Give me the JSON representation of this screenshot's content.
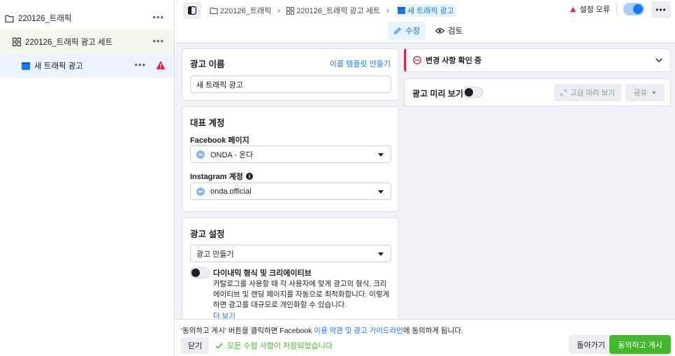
{
  "sidebar": {
    "campaign": "220126_트래픽",
    "adset": "220126_트래픽 광고 세트",
    "ad": "새 트래픽 광고",
    "more": "•••"
  },
  "topbar": {
    "breadcrumbs": [
      "220126_트래픽",
      "220126_트래픽 광고 세트",
      "새 트래픽 광고"
    ],
    "status": "설정 오류",
    "more": "•••",
    "tabs": {
      "edit": "수정",
      "review": "검토"
    }
  },
  "ad_name": {
    "title": "광고 이름",
    "template_link": "이름 템플릿 만들기",
    "value": "새 트래픽 광고"
  },
  "identity": {
    "title": "대표 계정",
    "facebook_label": "Facebook 페이지",
    "facebook_value": "ONDA - 온다",
    "instagram_label": "Instagram 계정",
    "instagram_value": "onda.official"
  },
  "ad_setup": {
    "title": "광고 설정",
    "select_value": "광고 만들기",
    "dynamic_title": "다이내믹 형식 및 크리에이티브",
    "dynamic_desc": "카탈로그를 사용할 때 각 사용자에 맞게 광고의 형식, 크리에이티브 및 랜딩 페이지를 자동으로 최적화합니다. 이렇게 하면 광고를 대규모로 개인화할 수 있습니다.",
    "more_link": "더 보기"
  },
  "changes": {
    "text": "변경 사항 확인 중"
  },
  "preview": {
    "title": "광고 미리 보기",
    "advanced": "고급 미리 보기",
    "share": "공유"
  },
  "footer": {
    "note_before": "'동의하고 게시' 버튼을 클릭하면 Facebook ",
    "note_link": "이용 약관 및 광고 가이드라인",
    "note_after": "에 동의하게 됩니다.",
    "close": "닫기",
    "saved": "모든 수정 사항이 저장되었습니다",
    "back": "돌아가기",
    "publish": "동의하고 게시"
  },
  "colors": {
    "accent": "#1877f2",
    "error": "#e41e3f",
    "success": "#42b72a"
  }
}
